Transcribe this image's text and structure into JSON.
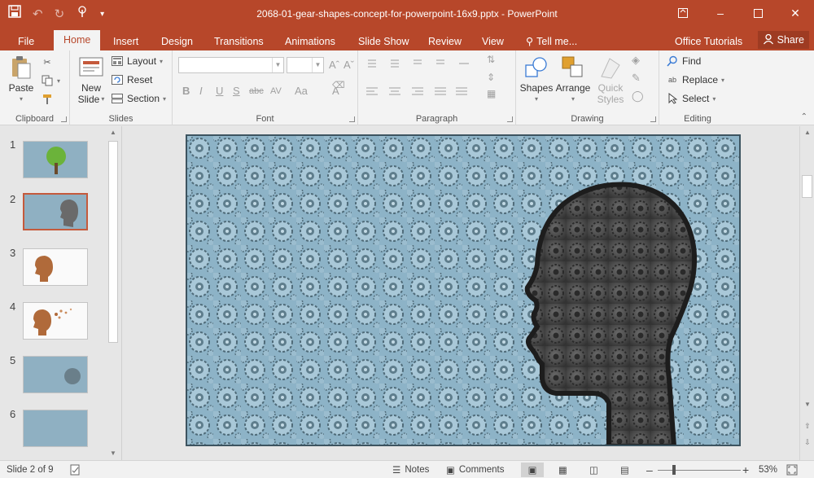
{
  "titlebar": {
    "doc_title": "2068-01-gear-shapes-concept-for-powerpoint-16x9.pptx - PowerPoint",
    "qat": [
      "save-icon",
      "undo-icon",
      "redo-icon",
      "touch-mode-icon",
      "customize-qat-icon"
    ],
    "window_controls": [
      "ribbon-display-options-icon",
      "minimize-icon",
      "restore-icon",
      "close-icon"
    ]
  },
  "tabs": {
    "file": "File",
    "home": "Home",
    "insert": "Insert",
    "design": "Design",
    "transitions": "Transitions",
    "animations": "Animations",
    "slideshow": "Slide Show",
    "review": "Review",
    "view": "View",
    "tellme": "Tell me...",
    "office_tutorials": "Office Tutorials",
    "share": "Share"
  },
  "ribbon": {
    "clipboard": {
      "label": "Clipboard",
      "paste": "Paste"
    },
    "slides": {
      "label": "Slides",
      "new_slide_line1": "New",
      "new_slide_line2": "Slide",
      "layout": "Layout",
      "reset": "Reset",
      "section": "Section"
    },
    "font": {
      "label": "Font",
      "buttons": [
        "B",
        "I",
        "U",
        "S",
        "abc",
        "AV",
        "Aa",
        "A"
      ]
    },
    "paragraph": {
      "label": "Paragraph"
    },
    "drawing": {
      "label": "Drawing",
      "shapes": "Shapes",
      "arrange": "Arrange",
      "quick_styles_line1": "Quick",
      "quick_styles_line2": "Styles"
    },
    "editing": {
      "label": "Editing",
      "find": "Find",
      "replace": "Replace",
      "select": "Select"
    }
  },
  "thumbnails": {
    "numbers": [
      "1",
      "2",
      "3",
      "4",
      "5",
      "6"
    ],
    "selected": "2"
  },
  "statusbar": {
    "slide_info": "Slide 2 of 9",
    "notes": "Notes",
    "comments": "Comments",
    "zoom": "53%"
  },
  "colors": {
    "accent": "#b7472a",
    "gear_blue": "#8db3c7",
    "head_gray": "#4a4a4a"
  }
}
